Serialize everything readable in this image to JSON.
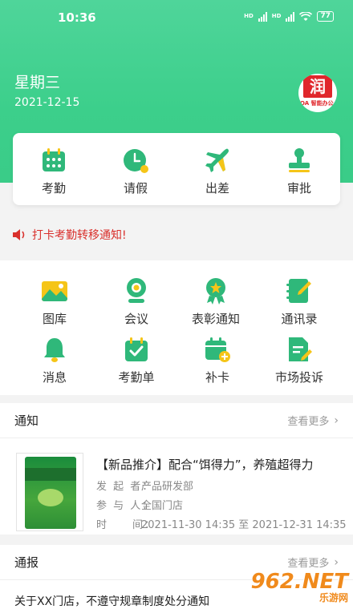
{
  "status_bar": {
    "time": "10:36",
    "battery": "77"
  },
  "header": {
    "weekday": "星期三",
    "date": "2021-12-15",
    "logo_char": "润",
    "logo_sub": "OA 智能办公"
  },
  "quick_actions": [
    {
      "label": "考勤",
      "icon": "calendar-icon"
    },
    {
      "label": "请假",
      "icon": "clock-icon"
    },
    {
      "label": "出差",
      "icon": "airplane-icon"
    },
    {
      "label": "审批",
      "icon": "stamp-icon"
    }
  ],
  "notice_bar": {
    "text": "打卡考勤转移通知!"
  },
  "apps": [
    {
      "label": "图库",
      "icon": "gallery-icon"
    },
    {
      "label": "会议",
      "icon": "webcam-icon"
    },
    {
      "label": "表彰通知",
      "icon": "award-icon"
    },
    {
      "label": "通讯录",
      "icon": "contacts-icon"
    },
    {
      "label": "消息",
      "icon": "bell-icon"
    },
    {
      "label": "考勤单",
      "icon": "attendance-sheet-icon"
    },
    {
      "label": "补卡",
      "icon": "calendar-add-icon"
    },
    {
      "label": "市场投诉",
      "icon": "complaint-icon"
    }
  ],
  "notices_section": {
    "title": "通知",
    "more": "查看更多",
    "item": {
      "title": "【新品推介】配合“饵得力”，养殖超得力",
      "sponsor_label": "发 起 者：",
      "sponsor": "产品研发部",
      "participants_label": "参 与 人：",
      "participants": "全国门店",
      "time_label": "时　　间：",
      "time": "2021-11-30 14:35 至 2021-12-31 14:35"
    }
  },
  "reports_section": {
    "title": "通报",
    "more": "查看更多",
    "first_item": "关于XX门店，不遵守规章制度处分通知"
  },
  "watermark": {
    "big": "962.NET",
    "small": "乐游网"
  },
  "colors": {
    "brand_green": "#3ccf8b",
    "alert_red": "#d9302c",
    "icon_green": "#2fb87a",
    "icon_yellow": "#f5c518"
  }
}
